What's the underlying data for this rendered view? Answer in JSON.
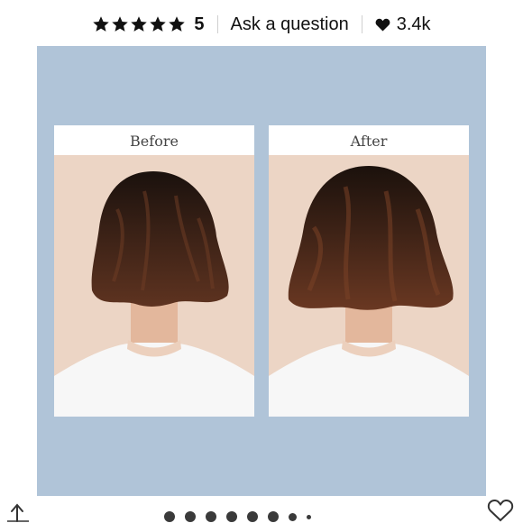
{
  "rating": {
    "stars_icon": "star-icon",
    "star_count": 5,
    "value": "5"
  },
  "ask_question": {
    "label": "Ask a question"
  },
  "likes": {
    "icon": "heart-filled-icon",
    "count": "3.4k"
  },
  "gallery": {
    "before_label": "Before",
    "after_label": "After",
    "background_color": "#b0c4d8",
    "page_count": 8
  },
  "bottom_bar": {
    "share_icon": "share-icon",
    "favorite_icon": "heart-outline-icon"
  }
}
